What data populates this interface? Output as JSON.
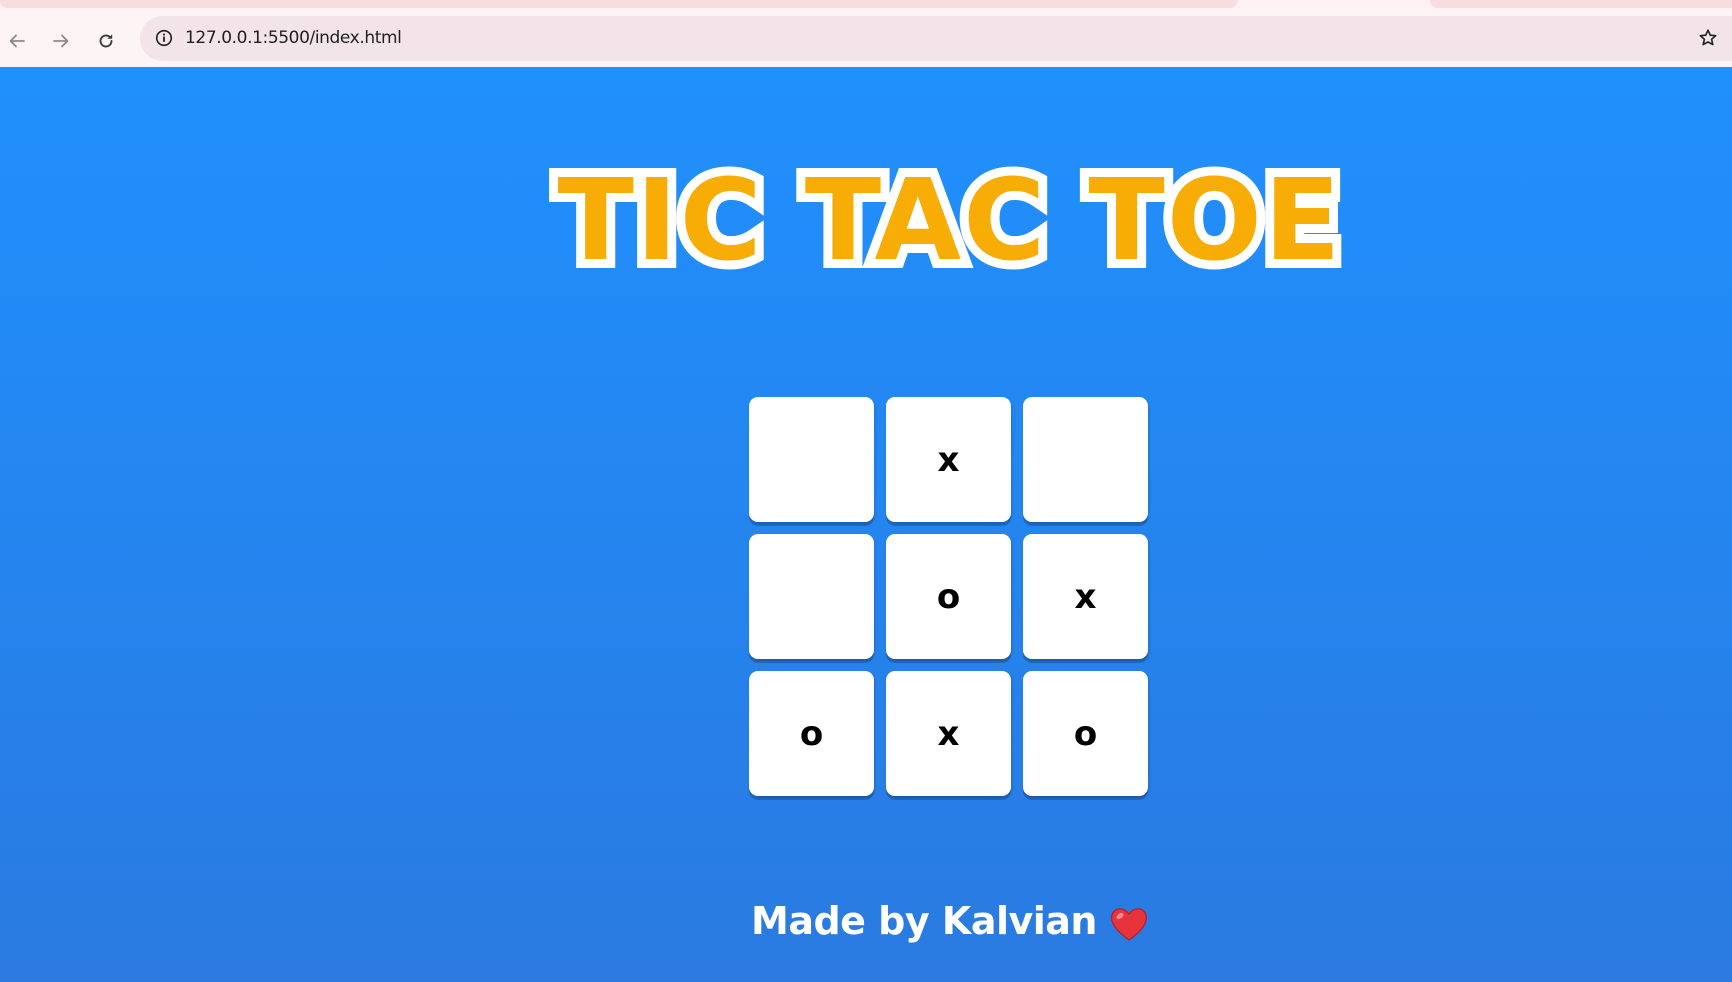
{
  "browser": {
    "url": "127.0.0.1:5500/index.html",
    "icons": [
      "back-icon",
      "forward-icon",
      "reload-icon",
      "site-info-icon",
      "bookmark-star-icon"
    ]
  },
  "page": {
    "title": "TIC TAC TOE",
    "board": [
      [
        "",
        "x",
        ""
      ],
      [
        "",
        "o",
        "x"
      ],
      [
        "o",
        "x",
        "o"
      ]
    ],
    "footer_text": "Made by Kalvian",
    "footer_icon": "heart-icon",
    "colors": {
      "background_top": "#2090fd",
      "background_bottom": "#2a7ae0",
      "title_fill": "#f7ac06",
      "title_outline": "#ffffff",
      "cell": "#ffffff",
      "heart": "#e8323c"
    }
  }
}
